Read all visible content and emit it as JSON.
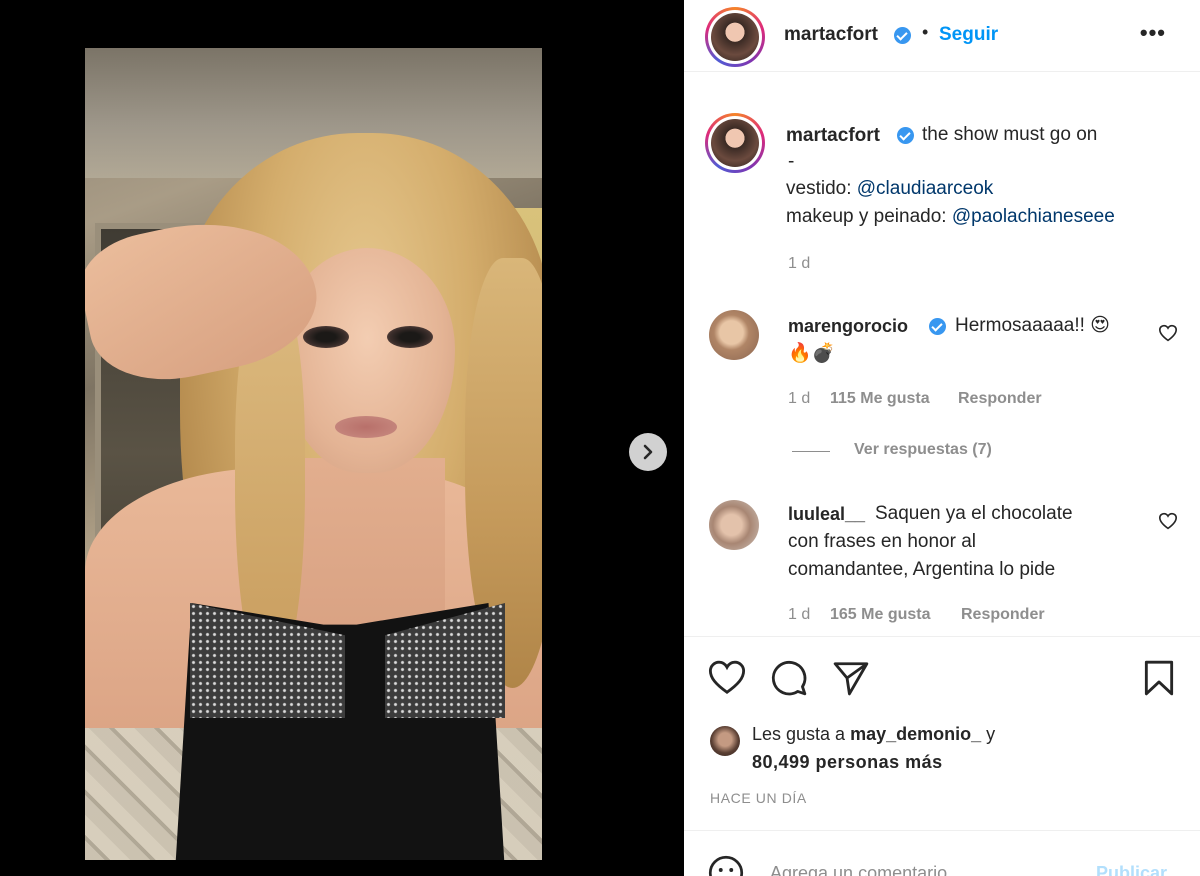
{
  "post": {
    "username": "martacfort",
    "follow_label": "Seguir",
    "more_label": "•••",
    "separator": "•"
  },
  "caption": {
    "username": "martacfort",
    "text_line1": "the show must go on",
    "text_line2": "-",
    "dress_prefix": "vestido: ",
    "dress_mention": "@claudiaarceok",
    "makeup_prefix": "makeup y peinado: ",
    "makeup_mention": "@paolachianeseee",
    "age": "1 d"
  },
  "comments": [
    {
      "username": "marengorocio",
      "verified": true,
      "text_line1": "Hermosaaaaa!! 😍",
      "text_line2": "🔥💣",
      "age": "1 d",
      "likes": "115 Me gusta",
      "reply": "Responder",
      "view_replies": "Ver respuestas (7)"
    },
    {
      "username": "luuleal__",
      "verified": false,
      "text_line1": "Saquen ya el chocolate",
      "text_line2": "con frases en honor al",
      "text_line3": "comandantee, Argentina lo pide",
      "age": "1 d",
      "likes": "165 Me gusta",
      "reply": "Responder"
    }
  ],
  "likes_summary": {
    "prefix": "Les gusta a ",
    "user": "may_demonio_",
    "suffix": " y",
    "count_text": "80,499 personas más"
  },
  "timestamp": "HACE UN DÍA",
  "composer": {
    "placeholder": "Agrega un comentario...",
    "publish_label": "Publicar"
  },
  "colors": {
    "accent": "#0095f6",
    "verified": "#3897f0",
    "muted": "#8e8e8e",
    "mention": "#00376b"
  },
  "icons": [
    "chevron-right-icon",
    "heart-icon",
    "comment-icon",
    "share-icon",
    "bookmark-icon",
    "emoji-icon",
    "verified-badge-icon",
    "more-options-icon"
  ]
}
